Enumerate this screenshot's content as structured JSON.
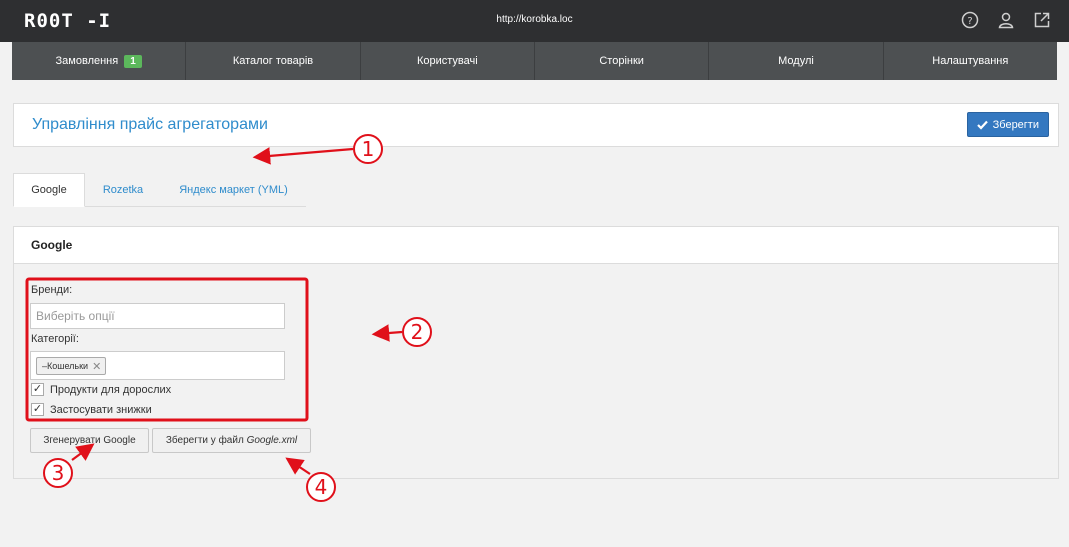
{
  "header": {
    "logo": "R00T -I",
    "site_url": "http://korobka.loc",
    "icons": [
      "help-icon",
      "user-icon",
      "external-link-icon"
    ]
  },
  "nav": {
    "items": [
      {
        "label": "Замовлення",
        "badge": "1"
      },
      {
        "label": "Каталог товарів"
      },
      {
        "label": "Користувачі"
      },
      {
        "label": "Сторінки"
      },
      {
        "label": "Модулі"
      },
      {
        "label": "Налаштування"
      }
    ]
  },
  "page": {
    "title": "Управління прайс агрегаторами",
    "save_label": "Зберегти"
  },
  "tabs": [
    {
      "label": "Google",
      "active": true
    },
    {
      "label": "Rozetka",
      "active": false
    },
    {
      "label": "Яндекс маркет (YML)",
      "active": false
    }
  ],
  "panel": {
    "title": "Google",
    "brands_label": "Бренди:",
    "brands_placeholder": "Виберіть опції",
    "categories_label": "Категорії:",
    "category_chip": "–Кошельки",
    "checkbox_adult": {
      "label": "Продукти для дорослих",
      "checked": true
    },
    "checkbox_discounts": {
      "label": "Застосувати знижки",
      "checked": true
    },
    "generate_label": "Згенерувати Google",
    "save_file_prefix": "Зберегти у файл ",
    "save_file_name": "Google.xml"
  },
  "annotations": {
    "markers": [
      "1",
      "2",
      "3",
      "4"
    ],
    "color": "#e0101a"
  },
  "colors": {
    "topbar": "#2e2f31",
    "nav": "#4d5052",
    "accent": "#2f8ccc",
    "primary_button": "#3478c0",
    "badge": "#5cb85c"
  }
}
